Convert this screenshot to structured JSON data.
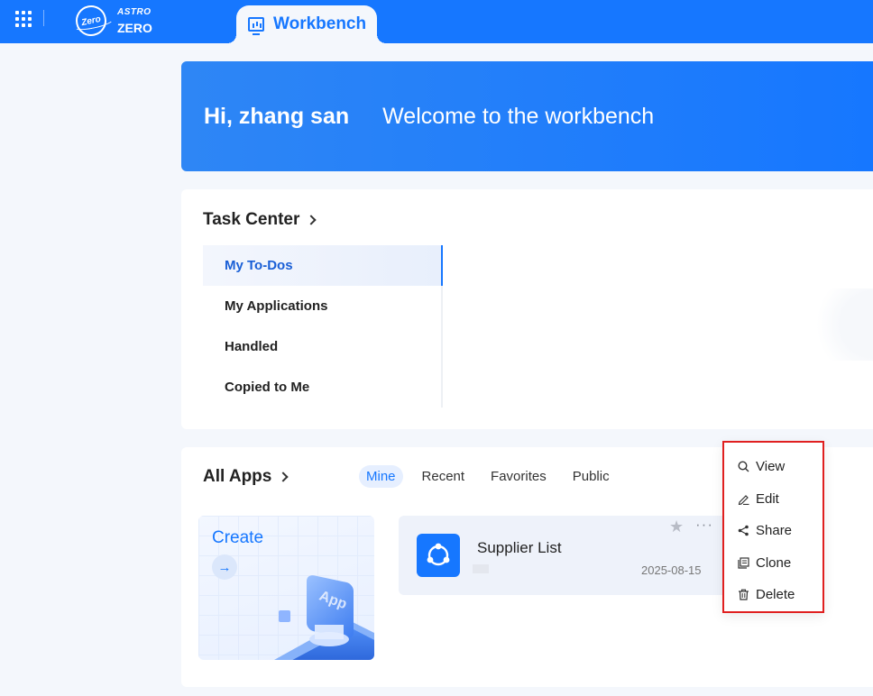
{
  "topbar": {
    "logo_line1": "ASTRO",
    "logo_line2": "ZERO",
    "logo_badge": "Zero",
    "active_tab": "Workbench",
    "color": "#1677ff"
  },
  "banner": {
    "greeting": "Hi, zhang san",
    "welcome": "Welcome to the workbench"
  },
  "task_center": {
    "title": "Task Center",
    "items": [
      {
        "label": "My To-Dos",
        "active": true
      },
      {
        "label": "My Applications",
        "active": false
      },
      {
        "label": "Handled",
        "active": false
      },
      {
        "label": "Copied to Me",
        "active": false
      }
    ]
  },
  "all_apps": {
    "title": "All Apps",
    "tabs": [
      {
        "label": "Mine",
        "active": true
      },
      {
        "label": "Recent",
        "active": false
      },
      {
        "label": "Favorites",
        "active": false
      },
      {
        "label": "Public",
        "active": false
      }
    ],
    "create_label": "Create",
    "apps": [
      {
        "name": "Supplier List",
        "date": "2025-08-15"
      }
    ]
  },
  "context_menu": {
    "items": [
      {
        "label": "View",
        "icon": "search-icon"
      },
      {
        "label": "Edit",
        "icon": "pen-icon"
      },
      {
        "label": "Share",
        "icon": "share-icon"
      },
      {
        "label": "Clone",
        "icon": "copy-icon"
      },
      {
        "label": "Delete",
        "icon": "trash-icon"
      }
    ]
  }
}
